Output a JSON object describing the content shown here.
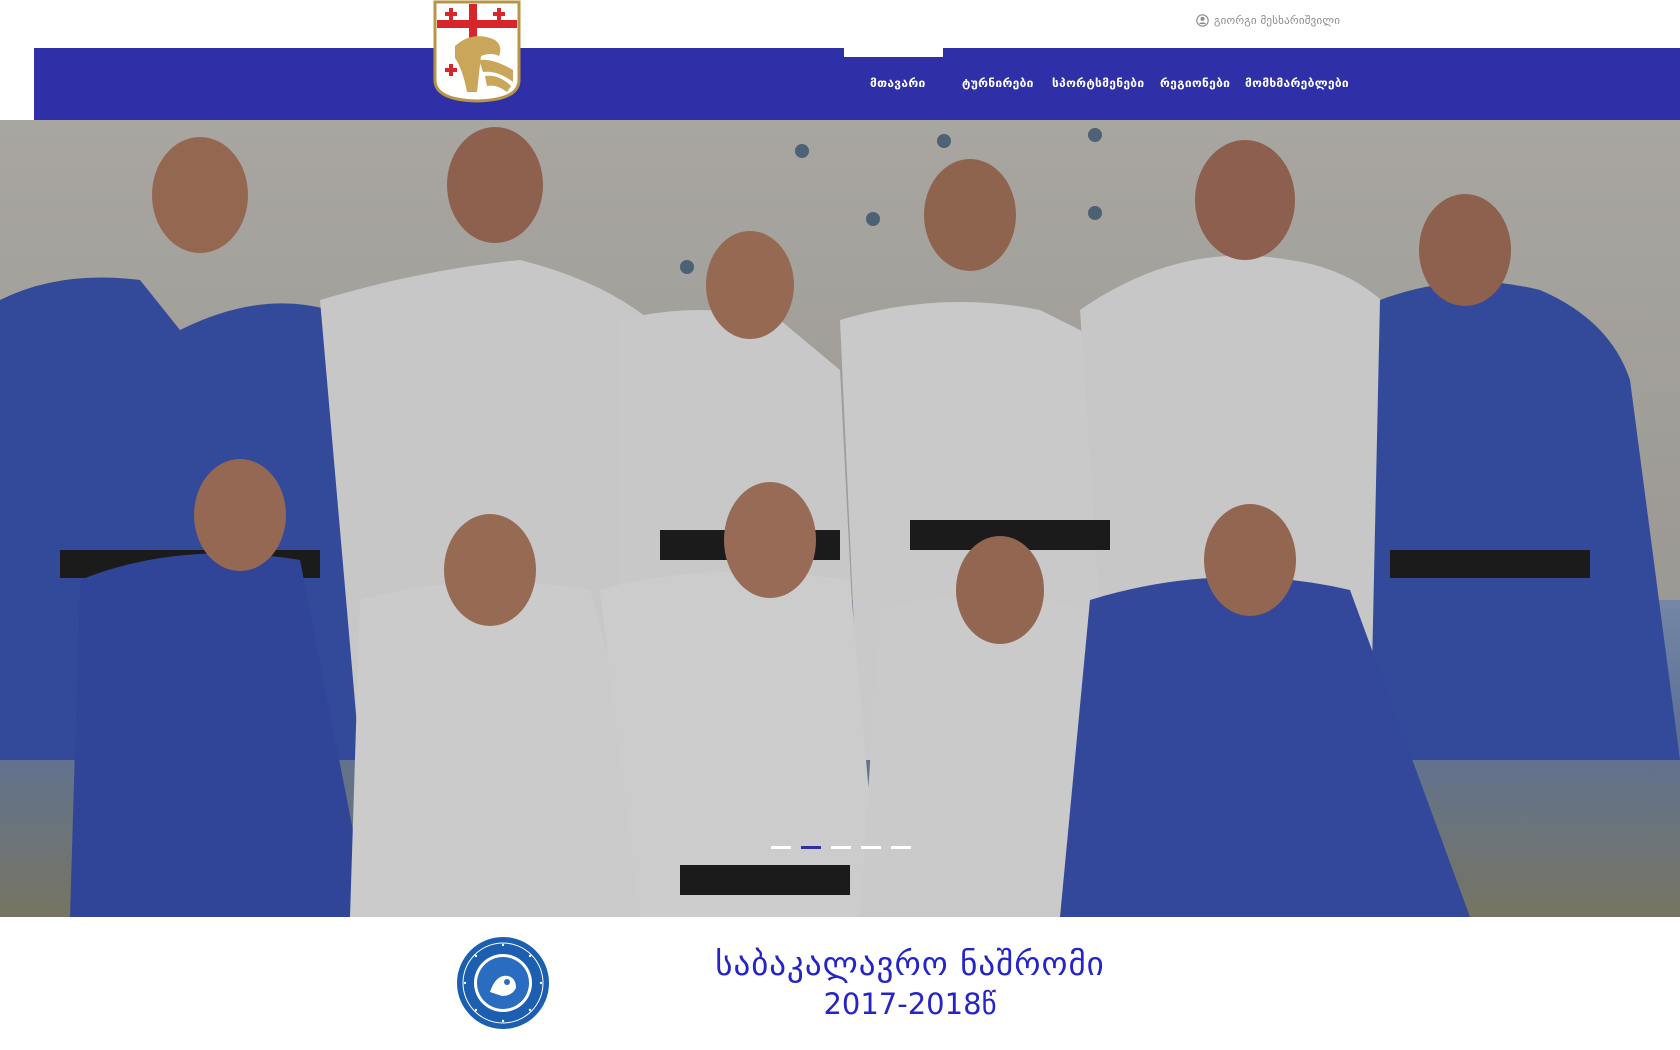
{
  "header": {
    "user_name": "გიორგი მესხარიშვილი",
    "logo_icon": "georgian-judo-federation-crest"
  },
  "nav": {
    "items": [
      {
        "label": "მთავარი",
        "active": true
      },
      {
        "label": "ტურნირები",
        "active": false
      },
      {
        "label": "სპორტსმენები",
        "active": false
      },
      {
        "label": "რეგიონები",
        "active": false
      },
      {
        "label": "მომხმარებლები",
        "active": false
      }
    ]
  },
  "hero": {
    "slide_count": 5,
    "active_slide": 2
  },
  "footer": {
    "title": "საბაკალავრო ნაშრომი",
    "year": "2017-2018წ",
    "seal_icon": "tbilisi-state-university-seal"
  },
  "colors": {
    "primary": "#2f2fa8",
    "title_blue": "#2424c8",
    "white": "#ffffff"
  }
}
